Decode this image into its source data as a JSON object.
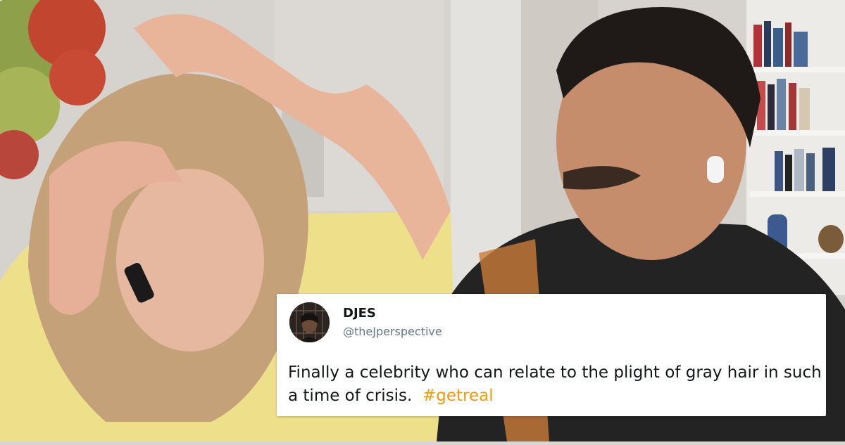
{
  "tweet": {
    "display_name": "DJES",
    "handle": "@theJperspective",
    "text": "Finally a celebrity who can relate to the plight of gray hair in such a time of crisis.",
    "hashtag": "#getreal",
    "hashtag_color": "#f29a0f"
  },
  "photo": {
    "icon": "video-call-photo"
  }
}
